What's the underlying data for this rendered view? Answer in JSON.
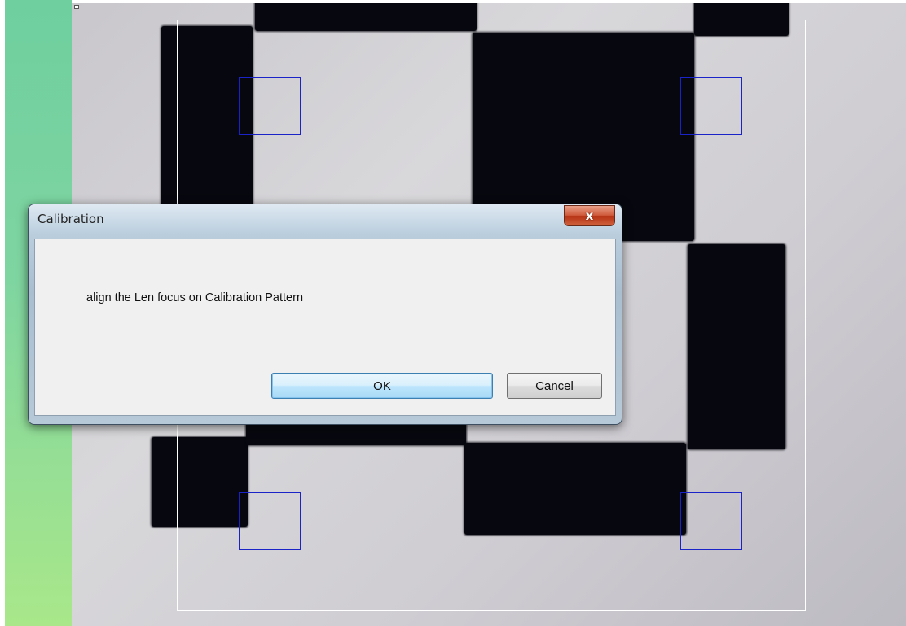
{
  "dialog": {
    "title": "Calibration",
    "message": "align the Len focus on Calibration Pattern",
    "ok_label": "OK",
    "cancel_label": "Cancel",
    "close_icon": "close-icon",
    "close_glyph": "x"
  },
  "colors": {
    "target_box": "#1a23c8",
    "roi_frame": "#ffffff",
    "close_button": "#c8482a",
    "ok_button_border": "#3c7fb1"
  }
}
